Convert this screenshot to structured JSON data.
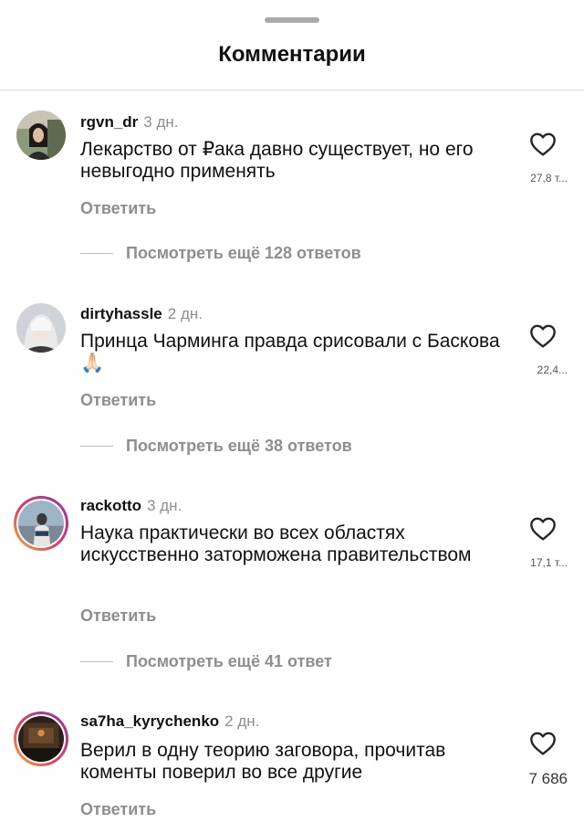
{
  "header": {
    "title": "Комментарии"
  },
  "comments": [
    {
      "username": "rgvn_dr",
      "time": "3 дн.",
      "text": "Лекарство от ₽ака давно существует, но его невыгодно применять",
      "reply": "Ответить",
      "likes": "27,8 т...",
      "more_replies": "Посмотреть ещё 128 ответов"
    },
    {
      "username": "dirtyhassle",
      "time": "2 дн.",
      "text": "Принца Чарминга правда срисовали с Баскова 🙏🏻",
      "reply": "Ответить",
      "likes": "22,4...",
      "more_replies": "Посмотреть ещё 38 ответов"
    },
    {
      "username": "rackotto",
      "time": "3 дн.",
      "text": "Наука практически во всех областях искусственно заторможена правительством",
      "reply": "Ответить",
      "likes": "17,1 т...",
      "more_replies": "Посмотреть ещё 41 ответ"
    },
    {
      "username": "sa7ha_kyrychenko",
      "time": "2 дн.",
      "text": "Верил  в одну теорию заговора, прочитав коменты поверил во все другие",
      "reply": "Ответить",
      "likes": "7 686"
    }
  ]
}
